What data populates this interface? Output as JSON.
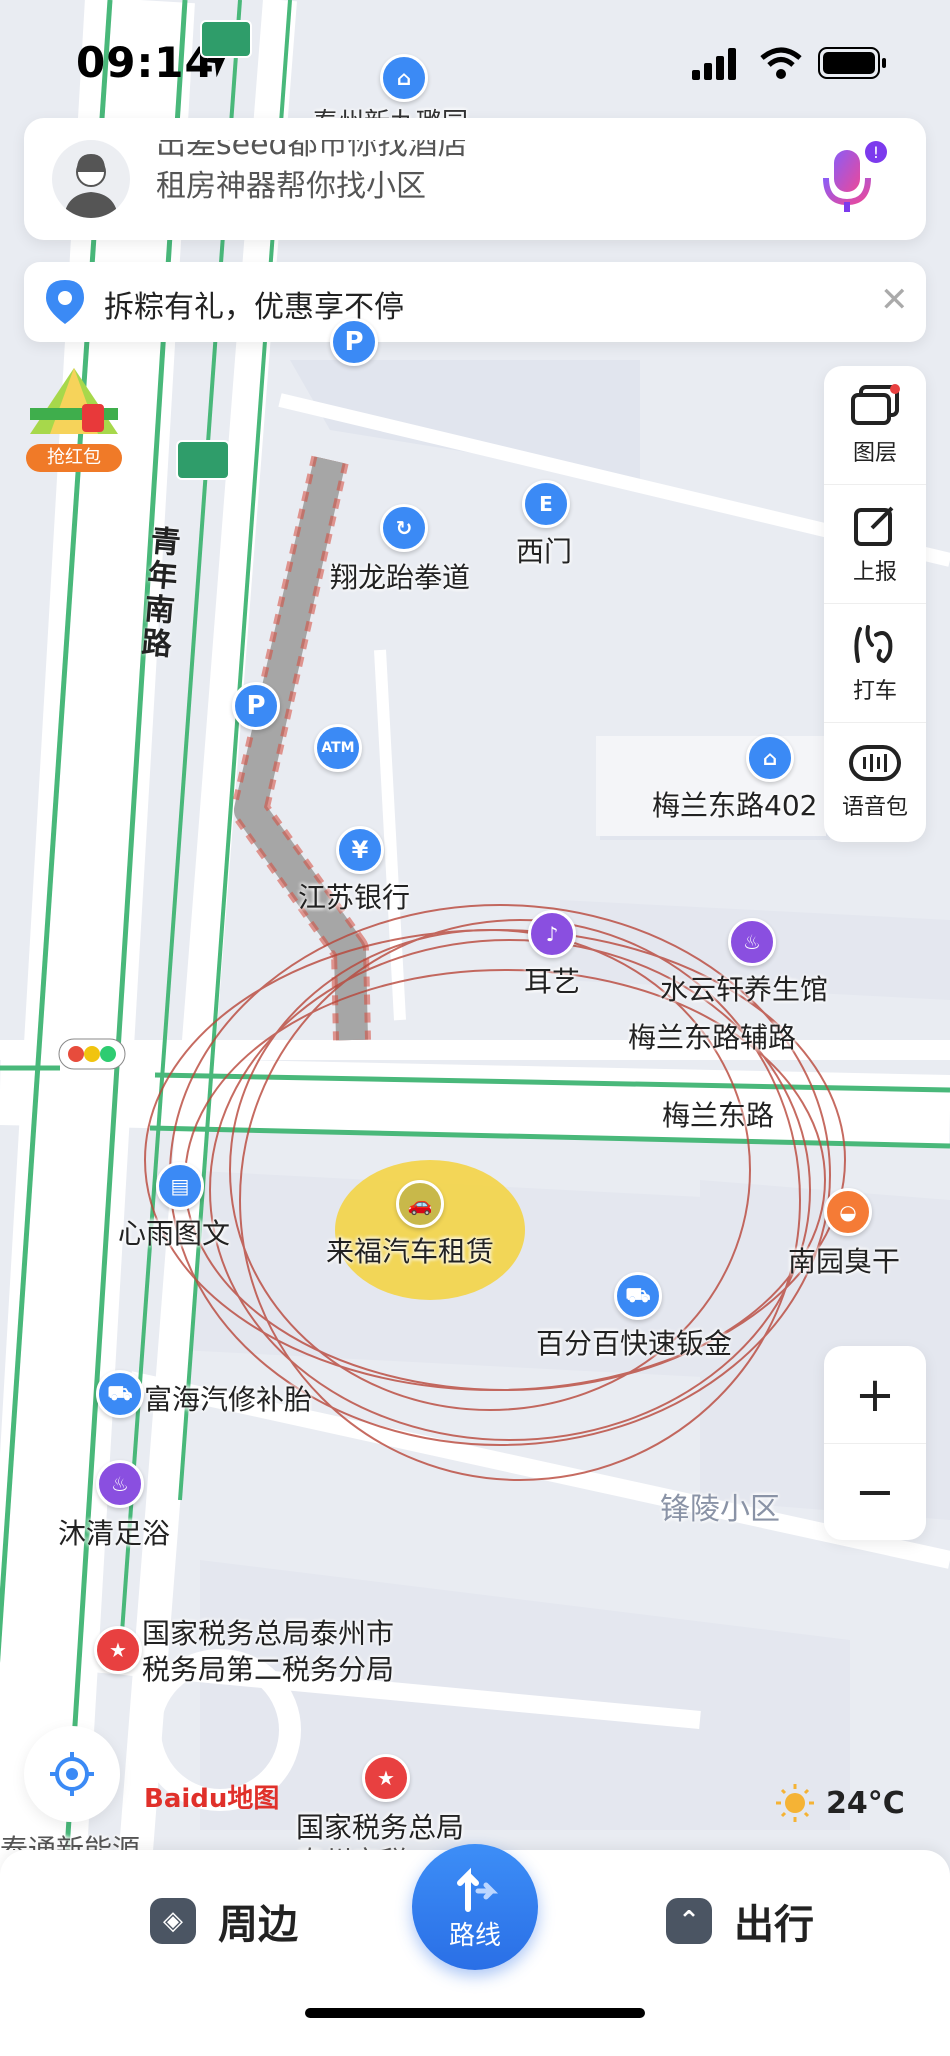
{
  "status_bar": {
    "time": "09:14"
  },
  "search": {
    "placeholder_line1": "出差seed都市你找酒店",
    "placeholder_line2": "租房神器帮你找小区"
  },
  "promo": {
    "text": "拆粽有礼，优惠享不停"
  },
  "red_packet": {
    "label": "抢红包"
  },
  "tools": [
    {
      "icon": "layers-icon",
      "label": "图层"
    },
    {
      "icon": "report-icon",
      "label": "上报"
    },
    {
      "icon": "taxi-icon",
      "label": "打车"
    },
    {
      "icon": "voice-pack-icon",
      "label": "语音包"
    }
  ],
  "map_labels": {
    "top_poi": "泰州新九璐园",
    "road_qingnian": "青年南路",
    "xianglong": "翔龙跆拳道",
    "ximen": "西门",
    "meilan402": "梅兰东路402",
    "jiangsu_bank": "江苏银行",
    "eryi": "耳艺",
    "shuiyunxuan": "水云轩养生馆",
    "meilan_fulu": "梅兰东路辅路",
    "meilan": "梅兰东路",
    "xinyu": "心雨图文",
    "laifu": "来福汽车租赁",
    "nanyuan": "南园臭干",
    "baifenbai": "百分百快速钣金",
    "fuhai": "富海汽修补胎",
    "fengling": "锋陵小区",
    "muqing": "沐清足浴",
    "tax1_line1": "国家税务总局泰州市",
    "tax1_line2": "税务局第二税务分局",
    "tax2": "国家税务总局",
    "tax2_sub": "泰州市税",
    "bottom_left": "泰通新能源"
  },
  "zoom": {
    "in": "+",
    "out": "−"
  },
  "weather": {
    "temp": "24°C"
  },
  "logo": {
    "text": "Baidu地图"
  },
  "bottom_nav": {
    "nearby": "周边",
    "route": "路线",
    "travel": "出行"
  }
}
